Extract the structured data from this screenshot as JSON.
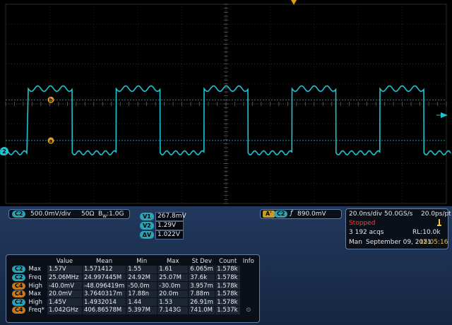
{
  "trigger_marker": {
    "color": "#e39a1c"
  },
  "waveform": {
    "color": "#1fc3cf",
    "high_level": 1.57,
    "low_level": -0.04,
    "frequency_mhz": 25.06,
    "channel_label": "2"
  },
  "cursors": {
    "a_label": "a",
    "b_label": "b",
    "a_color": "#e39a1c"
  },
  "channel_box": {
    "channel": "C2",
    "scale": "500.0mV/div",
    "impedance": "50Ω",
    "bandwidth": "1.0G",
    "bw_prefix": "B",
    "bw_sub": "W"
  },
  "cursor_readouts": [
    {
      "label": "V1",
      "value": "267.8mV"
    },
    {
      "label": "V2",
      "value": "1.29V"
    },
    {
      "label": "ΔV",
      "value": "1.022V"
    }
  ],
  "trigger_box": {
    "mode": "A'",
    "channel": "C2",
    "slope": "ƒ",
    "level": "890.0mV"
  },
  "timebase": {
    "time_div": "20.0ns/div",
    "sample_rate": "50.0GS/s",
    "resolution": "20.0ps/pt",
    "status": "Stopped",
    "status_color": "#ff3b3b",
    "acqs": "3 192 acqs",
    "record_length": "RL:10.0k",
    "mode": "Man",
    "date": "September 09, 2021",
    "time": "15:05:16",
    "time_color": "#e7c23d"
  },
  "measurements": {
    "headers": [
      "Value",
      "Mean",
      "Min",
      "Max",
      "St Dev",
      "Count",
      "Info"
    ],
    "rows": [
      {
        "source": "C2",
        "tag_color": "#2aa3b5",
        "name": "Max",
        "cells": [
          "1.57V",
          "1.571412",
          "1.55",
          "1.61",
          "6.065m",
          "1.578k",
          ""
        ]
      },
      {
        "source": "C2",
        "tag_color": "#2aa3b5",
        "name": "Freq",
        "cells": [
          "25.06MHz",
          "24.997445M",
          "24.92M",
          "25.07M",
          "37.6k",
          "1.578k",
          ""
        ]
      },
      {
        "source": "C4",
        "tag_color": "#c77a1f",
        "name": "High",
        "cells": [
          "-40.0mV",
          "-48.096419m",
          "-50.0m",
          "-30.0m",
          "3.957m",
          "1.578k",
          ""
        ]
      },
      {
        "source": "C4",
        "tag_color": "#c77a1f",
        "name": "Max",
        "cells": [
          "20.0mV",
          "3.7640317m",
          "17.88n",
          "20.0m",
          "7.88m",
          "1.578k",
          ""
        ]
      },
      {
        "source": "C2",
        "tag_color": "#2aa3b5",
        "name": "High",
        "cells": [
          "1.45V",
          "1.4932014",
          "1.44",
          "1.53",
          "26.91m",
          "1.578k",
          ""
        ]
      },
      {
        "source": "C4",
        "tag_color": "#c77a1f",
        "name": "Freq*",
        "cells": [
          "1.042GHz",
          "406.86578M",
          "5.397M",
          "7.143G",
          "741.0M",
          "1.537k",
          "⊙"
        ]
      }
    ]
  }
}
